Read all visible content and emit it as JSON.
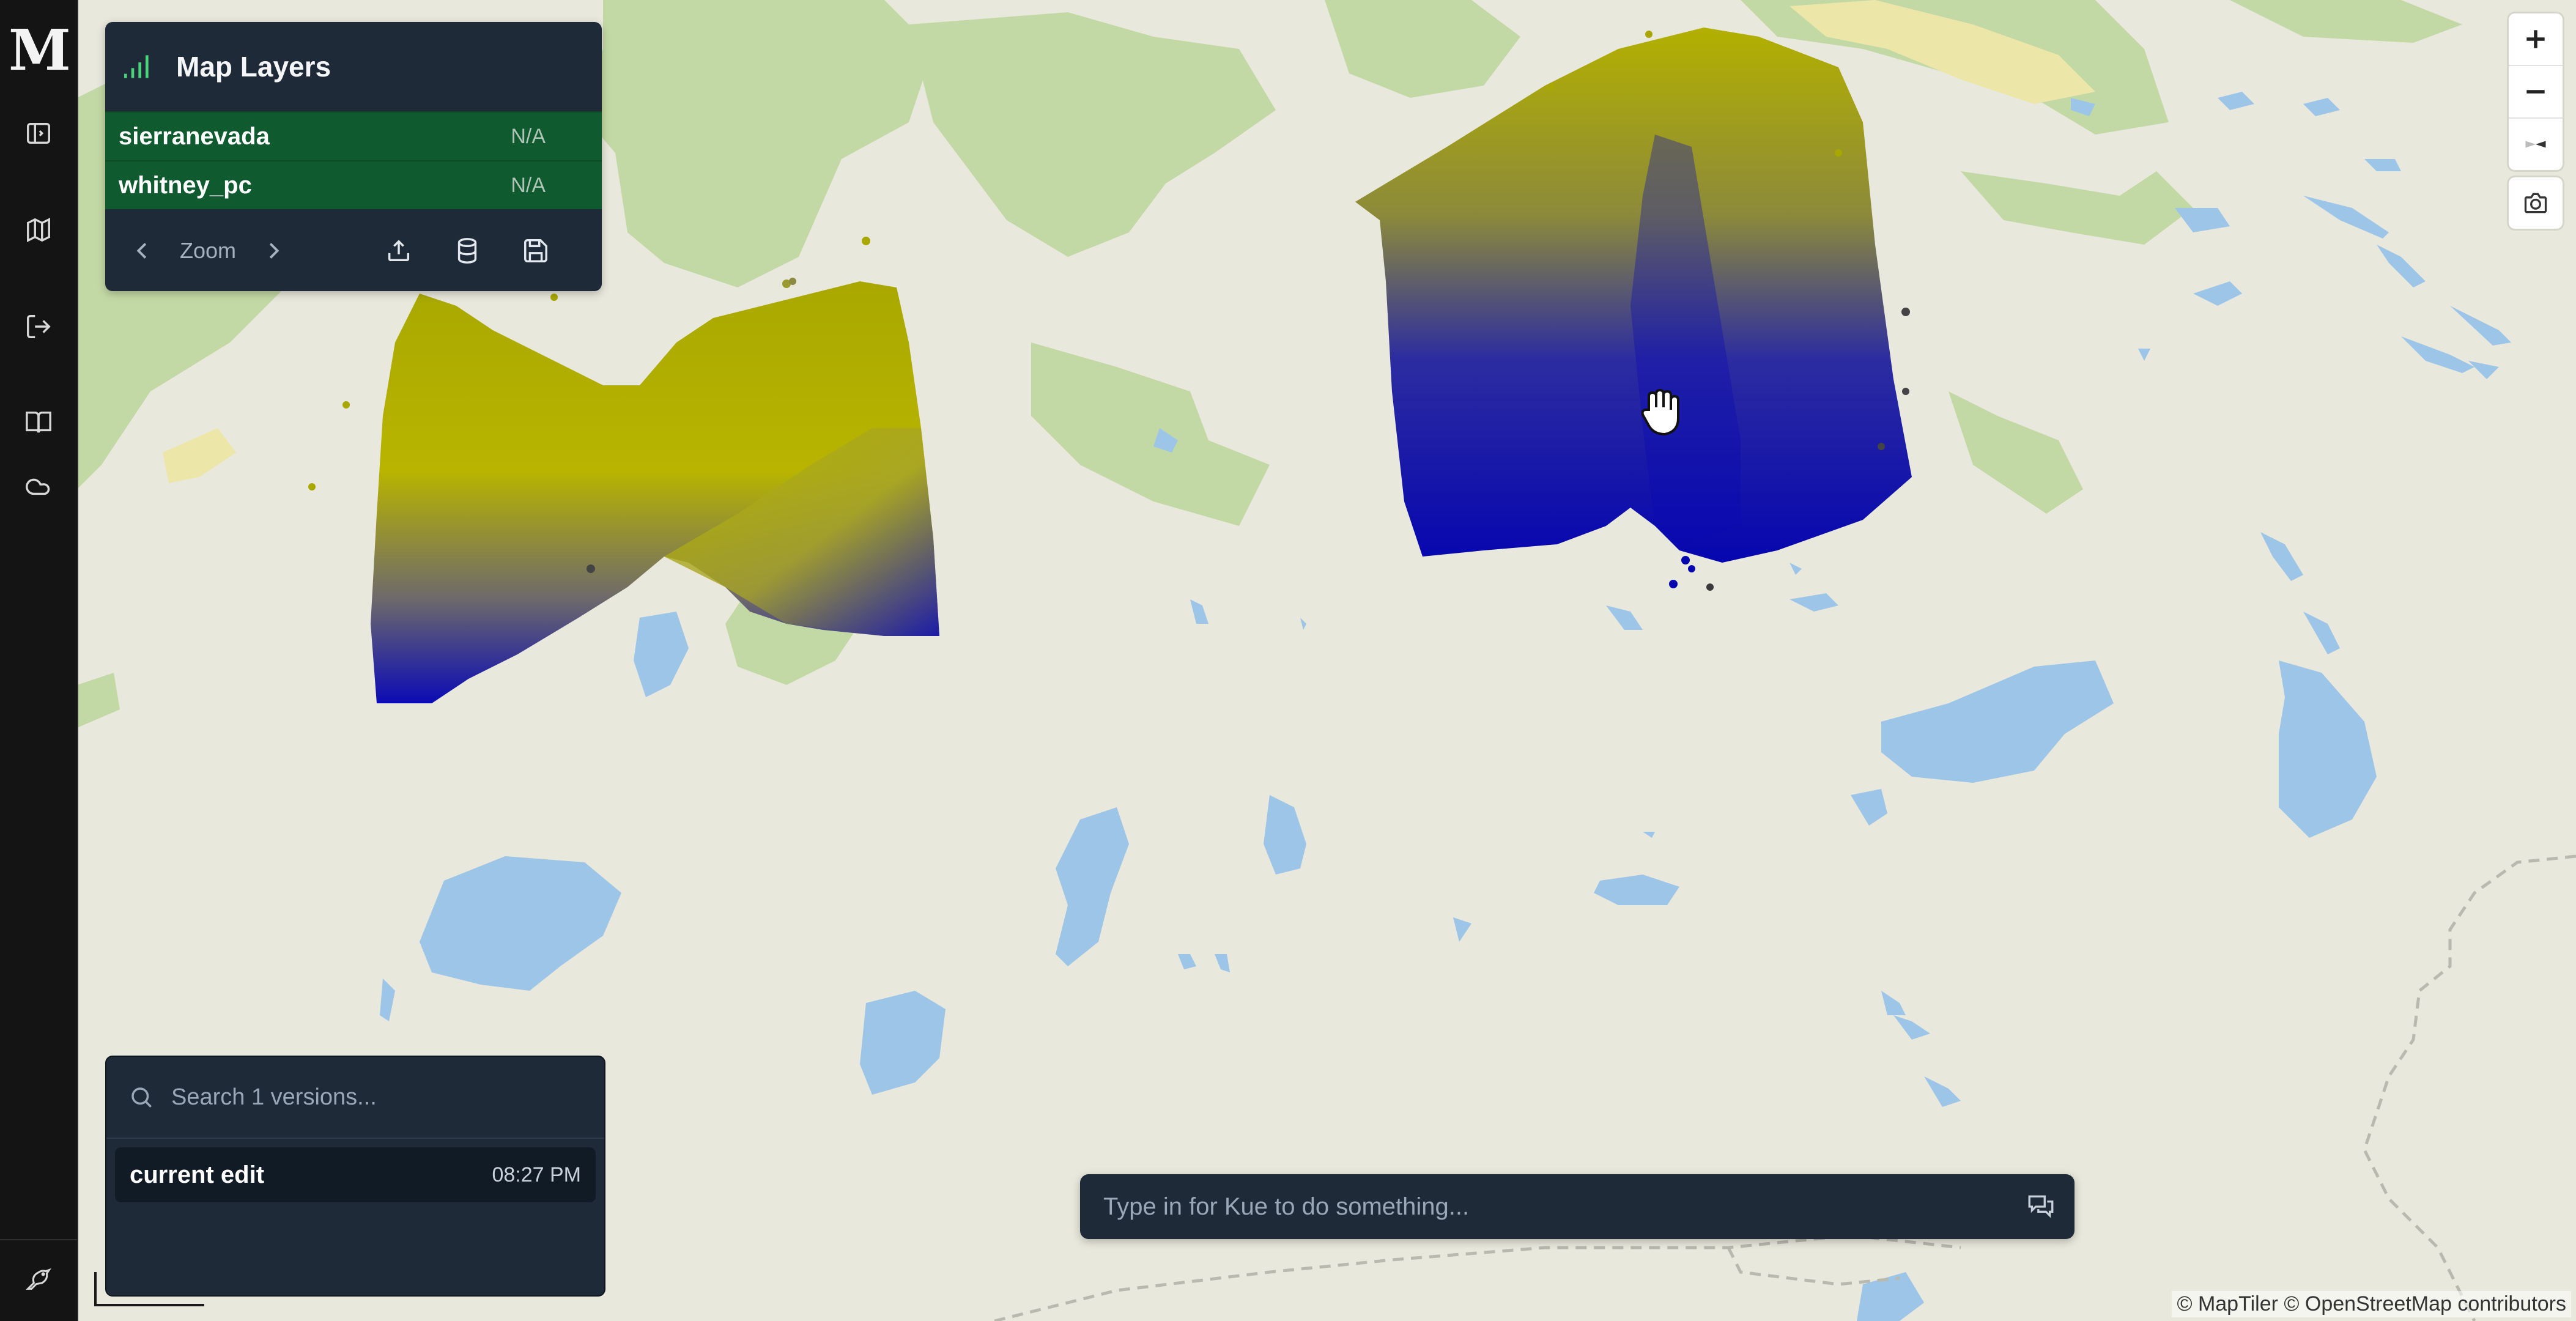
{
  "app": {
    "logo_text": "M"
  },
  "rail": {
    "items": [
      {
        "icon": "sidebar-panel-icon"
      },
      {
        "icon": "map-icon"
      },
      {
        "icon": "logout-icon"
      },
      {
        "icon": "book-icon"
      },
      {
        "icon": "cloud-icon"
      }
    ],
    "bottom_icon": "bird-icon"
  },
  "layers_panel": {
    "title": "Map Layers",
    "layers": [
      {
        "name": "sierranevada",
        "value": "N/A"
      },
      {
        "name": "whitney_pc",
        "value": "N/A"
      }
    ],
    "zoom_label": "Zoom"
  },
  "versions_panel": {
    "search_placeholder": "Search 1 versions...",
    "items": [
      {
        "name": "current edit",
        "time": "08:27 PM"
      }
    ]
  },
  "chat": {
    "placeholder": "Type in for Kue to do something..."
  },
  "attribution": "© MapTiler © OpenStreetMap contributors",
  "colors": {
    "panel_bg": "#1e2a38",
    "layer_row_bg": "#0f5a2e",
    "rail_bg": "#141414",
    "map_land": "#e9e8dc",
    "map_forest": "#c3d9a5",
    "map_water": "#9cc5e8",
    "pointcloud_high": "#b8b400",
    "pointcloud_low": "#0a0ab4"
  }
}
